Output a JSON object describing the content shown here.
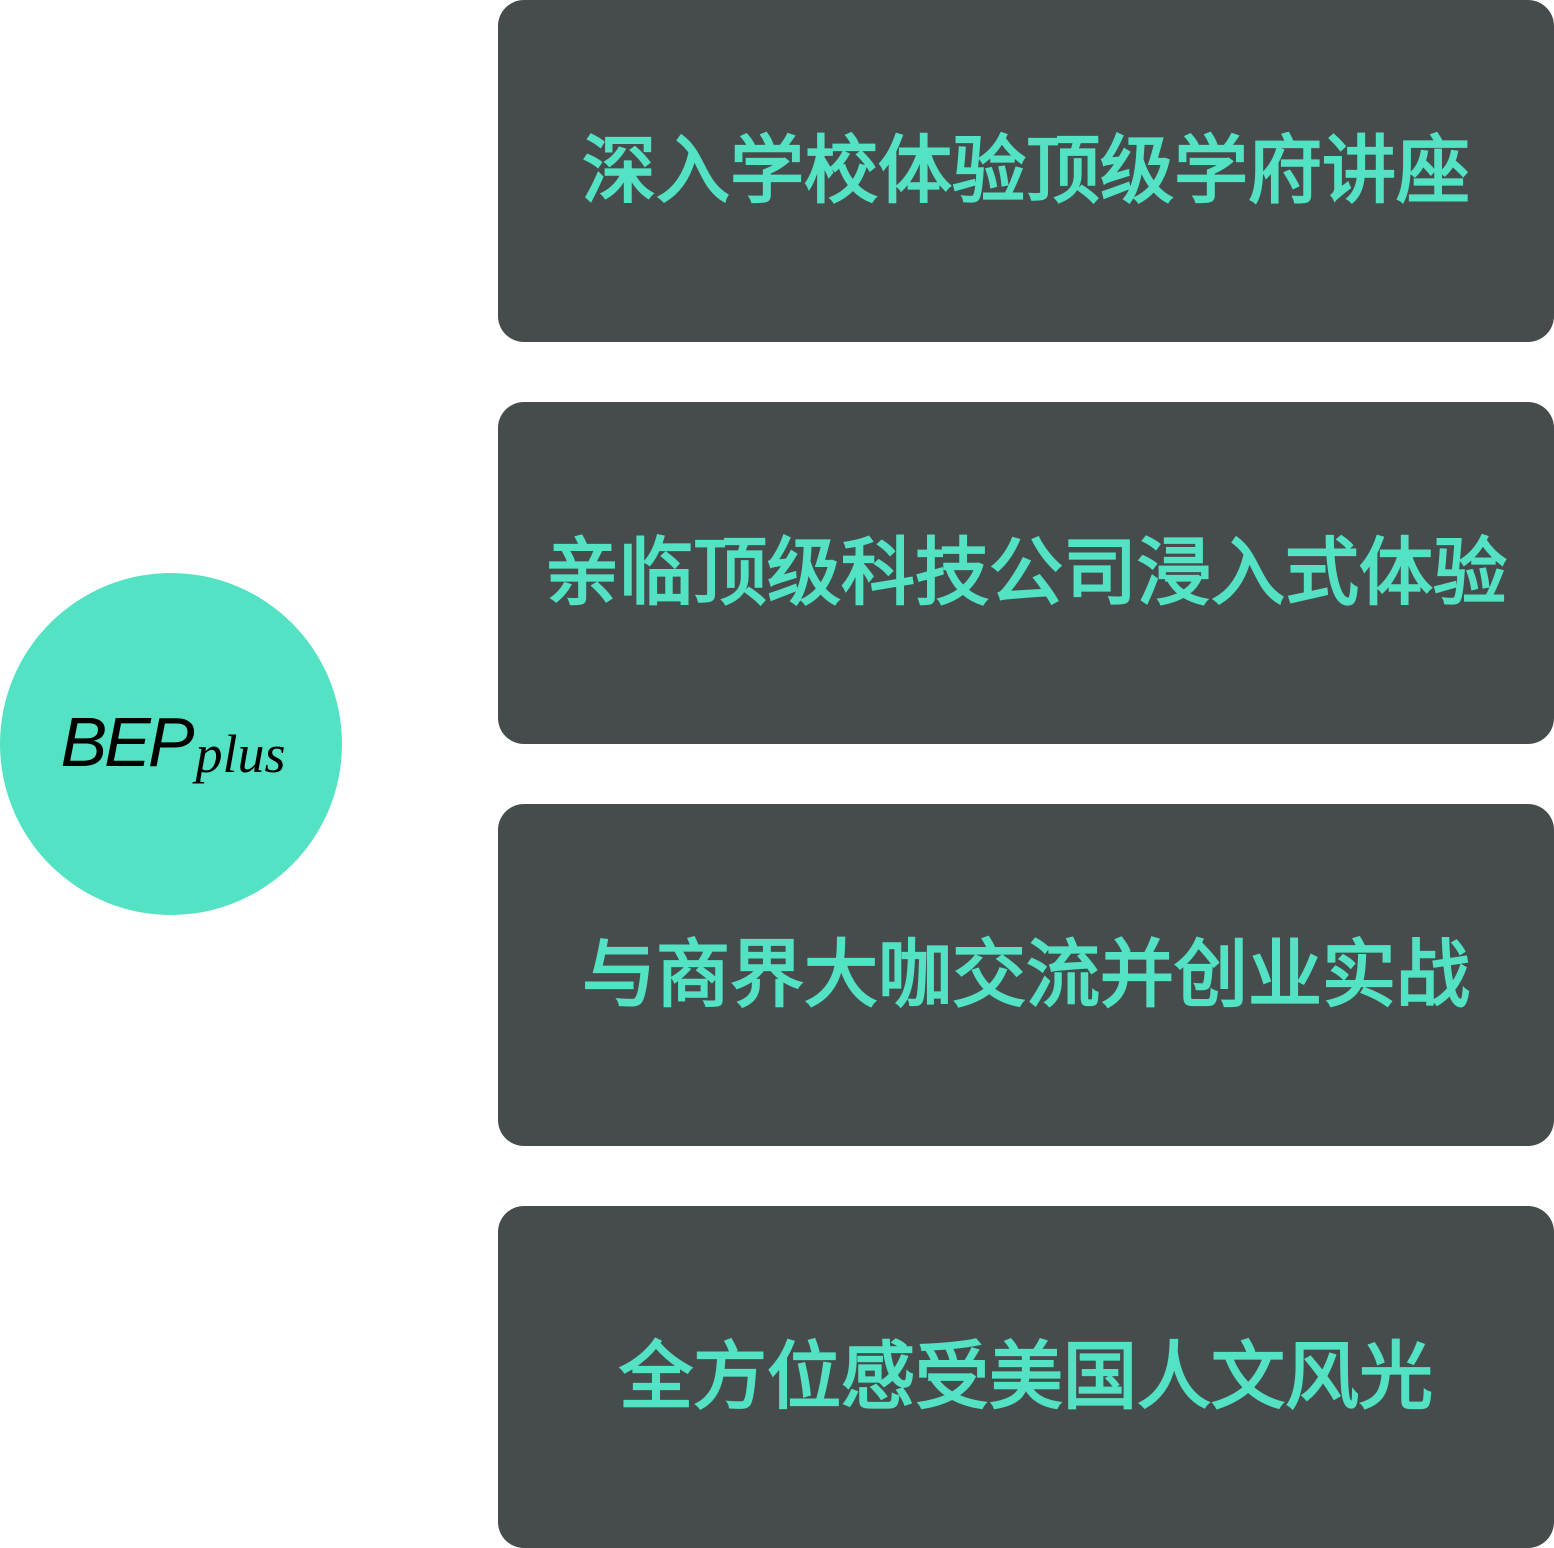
{
  "colors": {
    "accent": "#53e2c3",
    "card_bg": "#464c4c",
    "logo_text": "#000000"
  },
  "hub": {
    "logo_main": "BEP",
    "logo_sub": "plus"
  },
  "items": [
    {
      "label": "深入学校体验顶级学府讲座"
    },
    {
      "label": "亲临顶级科技公司浸入式体验"
    },
    {
      "label": "与商界大咖交流并创业实战"
    },
    {
      "label": "全方位感受美国人文风光"
    }
  ]
}
